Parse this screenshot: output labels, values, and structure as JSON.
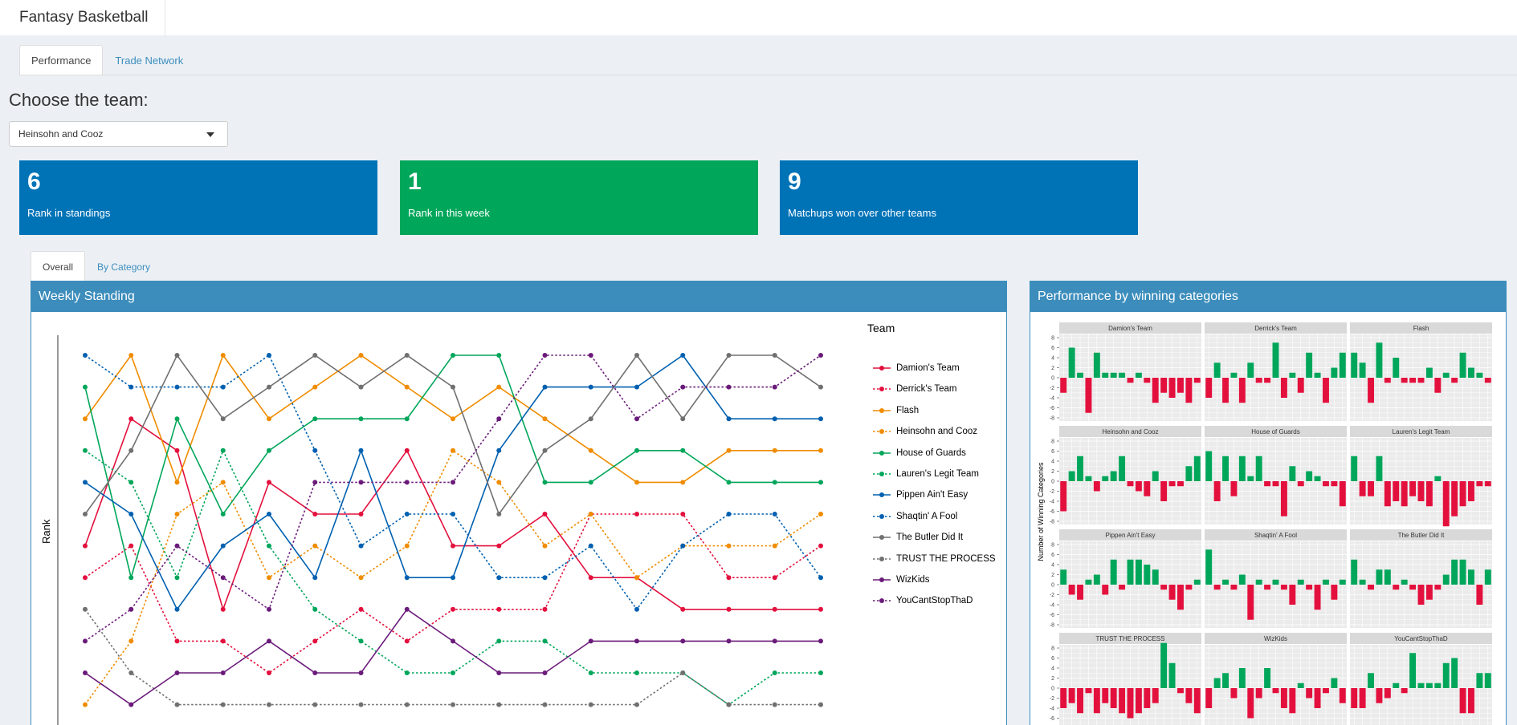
{
  "app": {
    "title": "Fantasy Basketball"
  },
  "tabs": [
    {
      "label": "Performance",
      "active": true
    },
    {
      "label": "Trade Network",
      "active": false
    }
  ],
  "team_select": {
    "heading": "Choose the team:",
    "value": "Heinsohn and Cooz"
  },
  "value_boxes": [
    {
      "value": "6",
      "label": "Rank in standings",
      "color": "#0073b7"
    },
    {
      "value": "1",
      "label": "Rank in this week",
      "color": "#00a65a"
    },
    {
      "value": "9",
      "label": "Matchups won over other teams",
      "color": "#0073b7"
    }
  ],
  "subtabs": [
    {
      "label": "Overall",
      "active": true
    },
    {
      "label": "By Category",
      "active": false
    }
  ],
  "weekly_panel": {
    "title": "Weekly Standing"
  },
  "category_panel": {
    "title": "Performance by winning categories"
  },
  "chart_data": [
    {
      "type": "line",
      "ylabel": "Rank",
      "legend_title": "Team",
      "y_reversed": true,
      "series": [
        {
          "name": "Damion's Team",
          "color": "#e3103d",
          "dash": false,
          "values": [
            7,
            3,
            4,
            9,
            5,
            6,
            6,
            4,
            7,
            7,
            6,
            8,
            8,
            9,
            9,
            9,
            9
          ]
        },
        {
          "name": "Derrick's Team",
          "color": "#e3103d",
          "dash": true,
          "values": [
            8,
            7,
            10,
            10,
            11,
            10,
            9,
            10,
            9,
            9,
            9,
            6,
            6,
            6,
            8,
            8,
            7
          ]
        },
        {
          "name": "Flash",
          "color": "#f08c00",
          "dash": false,
          "values": [
            3,
            1,
            5,
            1,
            3,
            2,
            1,
            2,
            3,
            2,
            3,
            4,
            5,
            5,
            4,
            4,
            4
          ]
        },
        {
          "name": "Heinsohn and Cooz",
          "color": "#f08c00",
          "dash": true,
          "values": [
            12,
            10,
            6,
            5,
            8,
            7,
            8,
            7,
            4,
            5,
            7,
            6,
            8,
            7,
            7,
            7,
            6
          ]
        },
        {
          "name": "House of Guards",
          "color": "#00a65a",
          "dash": false,
          "values": [
            2,
            8,
            3,
            6,
            4,
            3,
            3,
            3,
            1,
            1,
            5,
            5,
            4,
            4,
            5,
            5,
            5
          ]
        },
        {
          "name": "Lauren's Legit Team",
          "color": "#00a65a",
          "dash": true,
          "values": [
            4,
            5,
            8,
            4,
            7,
            9,
            10,
            11,
            11,
            10,
            10,
            11,
            11,
            11,
            12,
            11,
            11
          ]
        },
        {
          "name": "Pippen Ain't Easy",
          "color": "#0060b0",
          "dash": false,
          "values": [
            5,
            6,
            9,
            7,
            6,
            8,
            4,
            8,
            8,
            4,
            2,
            2,
            2,
            1,
            3,
            3,
            3
          ]
        },
        {
          "name": "Shaqtin' A Fool",
          "color": "#0060b0",
          "dash": true,
          "values": [
            1,
            2,
            2,
            2,
            1,
            4,
            7,
            6,
            6,
            8,
            8,
            7,
            9,
            7,
            6,
            6,
            8
          ]
        },
        {
          "name": "The Butler Did It",
          "color": "#707070",
          "dash": false,
          "values": [
            6,
            4,
            1,
            3,
            2,
            1,
            2,
            1,
            2,
            6,
            4,
            3,
            1,
            3,
            1,
            1,
            2
          ]
        },
        {
          "name": "TRUST THE PROCESS",
          "color": "#707070",
          "dash": true,
          "values": [
            9,
            11,
            12,
            12,
            12,
            12,
            12,
            12,
            12,
            12,
            12,
            12,
            12,
            11,
            12,
            12,
            12
          ]
        },
        {
          "name": "WizKids",
          "color": "#6a1b7a",
          "dash": false,
          "values": [
            11,
            12,
            11,
            11,
            10,
            11,
            11,
            9,
            10,
            11,
            11,
            10,
            10,
            10,
            10,
            10,
            10
          ]
        },
        {
          "name": "YouCantStopThaD",
          "color": "#6a1b7a",
          "dash": true,
          "values": [
            10,
            9,
            7,
            8,
            9,
            5,
            5,
            5,
            5,
            3,
            1,
            1,
            3,
            2,
            2,
            2,
            1
          ]
        }
      ]
    },
    {
      "type": "bar",
      "ylabel": "Number of Winning Categories",
      "ylim": [
        -8,
        8
      ],
      "yticks": [
        "8",
        "6",
        "4",
        "2",
        "0",
        "-2",
        "-4",
        "-6",
        "-8"
      ],
      "facets": [
        {
          "name": "Damion's Team",
          "values": [
            -3,
            6,
            1,
            -7,
            5,
            1,
            1,
            1,
            -1,
            1,
            -1,
            -5,
            -3,
            -4,
            -3,
            -5,
            -1
          ]
        },
        {
          "name": "Derrick's Team",
          "values": [
            -4,
            3,
            -5,
            1,
            -5,
            3,
            -1,
            -1,
            7,
            -4,
            1,
            -3,
            5,
            1,
            -5,
            2,
            5
          ]
        },
        {
          "name": "Flash",
          "values": [
            5,
            3,
            -5,
            7,
            -1,
            4,
            -1,
            -1,
            -1,
            2,
            -3,
            1,
            -1,
            5,
            2,
            1,
            -1
          ]
        },
        {
          "name": "Heinsohn and Cooz",
          "values": [
            -6,
            2,
            5,
            1,
            -2,
            1,
            2,
            5,
            -1,
            -2,
            -3,
            2,
            -4,
            -1,
            -1,
            3,
            5
          ]
        },
        {
          "name": "House of Guards",
          "values": [
            6,
            -4,
            5,
            -3,
            5,
            1,
            5,
            -1,
            -1,
            -7,
            3,
            -1,
            2,
            1,
            -1,
            -1,
            -5
          ]
        },
        {
          "name": "Lauren's Legit Team",
          "values": [
            5,
            -3,
            -3,
            5,
            -5,
            -4,
            -5,
            -3,
            -4,
            -5,
            1,
            -9,
            -7,
            -5,
            -4,
            -1,
            -1
          ]
        },
        {
          "name": "Pippen Ain't Easy",
          "values": [
            3,
            -2,
            -3,
            1,
            2,
            -2,
            5,
            -1,
            5,
            5,
            4,
            3,
            -1,
            -3,
            -5,
            -1,
            1
          ]
        },
        {
          "name": "Shaqtin' A Fool",
          "values": [
            7,
            -1,
            1,
            -1,
            2,
            -7,
            1,
            -1,
            1,
            -1,
            -4,
            1,
            -1,
            -5,
            1,
            -3,
            1
          ]
        },
        {
          "name": "The Butler Did It",
          "values": [
            5,
            1,
            -1,
            3,
            3,
            -1,
            1,
            -1,
            -4,
            -3,
            -1,
            2,
            5,
            5,
            3,
            -4,
            3
          ]
        },
        {
          "name": "TRUST THE PROCESS",
          "values": [
            -4,
            -3,
            -5,
            -1,
            -5,
            -3,
            -4,
            -5,
            -6,
            -5,
            -4,
            -3,
            9,
            5,
            -1,
            -3,
            -5
          ]
        },
        {
          "name": "WizKids",
          "values": [
            -4,
            2,
            3,
            -2,
            4,
            -6,
            -2,
            4,
            -1,
            -4,
            -5,
            1,
            -2,
            -4,
            -1,
            2,
            -3
          ]
        },
        {
          "name": "YouCantStopThaD",
          "values": [
            -4,
            -4,
            3,
            -3,
            -2,
            1,
            -1,
            7,
            1,
            1,
            1,
            5,
            6,
            -5,
            -5,
            3,
            3
          ]
        }
      ]
    }
  ]
}
